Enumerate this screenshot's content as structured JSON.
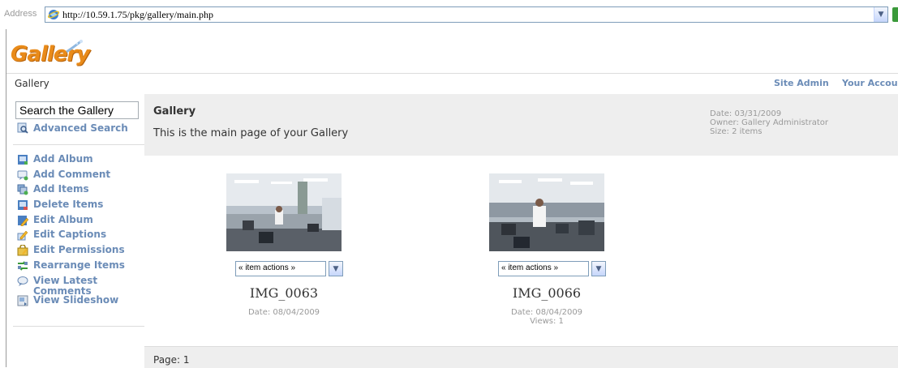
{
  "browser": {
    "address_label": "Address",
    "url": "http://10.59.1.75/pkg/gallery/main.php"
  },
  "header": {
    "logo_text": "Gallery",
    "title": "Gallery",
    "site_admin": "Site Admin",
    "your_account": "Your Account"
  },
  "sidebar": {
    "search_value": "Search the Gallery",
    "advanced_search": "Advanced Search",
    "items": [
      {
        "label": "Add Album",
        "icon": "add-album-icon"
      },
      {
        "label": "Add Comment",
        "icon": "add-comment-icon"
      },
      {
        "label": "Add Items",
        "icon": "add-items-icon"
      },
      {
        "label": "Delete Items",
        "icon": "delete-items-icon"
      },
      {
        "label": "Edit Album",
        "icon": "edit-album-icon"
      },
      {
        "label": "Edit Captions",
        "icon": "edit-captions-icon"
      },
      {
        "label": "Edit Permissions",
        "icon": "edit-permissions-icon"
      },
      {
        "label": "Rearrange Items",
        "icon": "rearrange-items-icon"
      },
      {
        "label": "View Latest Comments",
        "icon": "view-comments-icon"
      },
      {
        "label": "View Slideshow",
        "icon": "slideshow-icon"
      }
    ]
  },
  "main": {
    "title": "Gallery",
    "description": "This is the main page of your Gallery",
    "meta": {
      "date": "Date: 03/31/2009",
      "owner": "Owner: Gallery Administrator",
      "size": "Size: 2 items"
    },
    "items": [
      {
        "actions_label": "« item actions »",
        "title": "IMG_0063",
        "date": "Date: 08/04/2009",
        "views": ""
      },
      {
        "actions_label": "« item actions »",
        "title": "IMG_0066",
        "date": "Date: 08/04/2009",
        "views": "Views: 1"
      }
    ],
    "pager": "Page: 1"
  },
  "colors": {
    "link": "#6b8cb7",
    "logo_orange": "#e98b1a",
    "panel_gray": "#eeeeee"
  }
}
